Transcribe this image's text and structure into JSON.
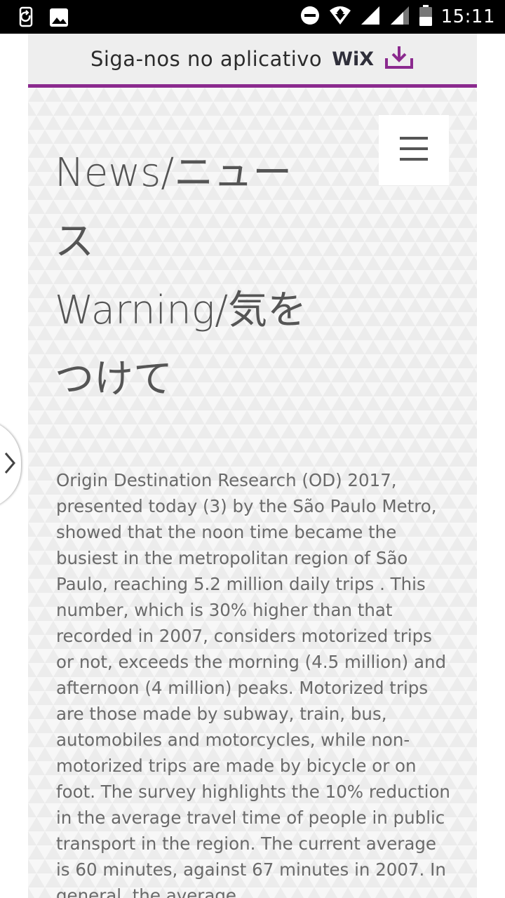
{
  "status_bar": {
    "time": "15:11",
    "icons": [
      "screen-rotate-icon",
      "image-icon",
      "do-not-disturb-icon",
      "wifi-icon",
      "cell-signal-icon",
      "cell-signal-2-icon",
      "battery-icon"
    ]
  },
  "wix_banner": {
    "text": "Siga-nos no aplicativo",
    "logo": "WiX",
    "icon": "download-icon",
    "accent_color": "#8b2a8e"
  },
  "menu": {
    "icon": "hamburger-menu-icon"
  },
  "article": {
    "title_lines": [
      "News/ニュー",
      "ス",
      "Warning/気を",
      "つけて"
    ],
    "body": "Origin Destination Research (OD) 2017, presented today (3) by the São Paulo Metro, showed that the noon time became the busiest in the metropolitan region of São Paulo, reaching 5.2 million daily trips . This number, which is 30% higher than that recorded in 2007, considers motorized trips or not, exceeds the morning (4.5 million) and afternoon (4 million) peaks. Motorized trips are those made by subway, train, bus, automobiles and motorcycles, while non-motorized trips are made by bicycle or on foot. The survey highlights the 10% reduction in the average travel time of people in public transport in the region. The current average is 60 minutes, against 67 minutes in 2007. In general, the average"
  },
  "side_nav": {
    "icon": "chevron-right-icon"
  }
}
